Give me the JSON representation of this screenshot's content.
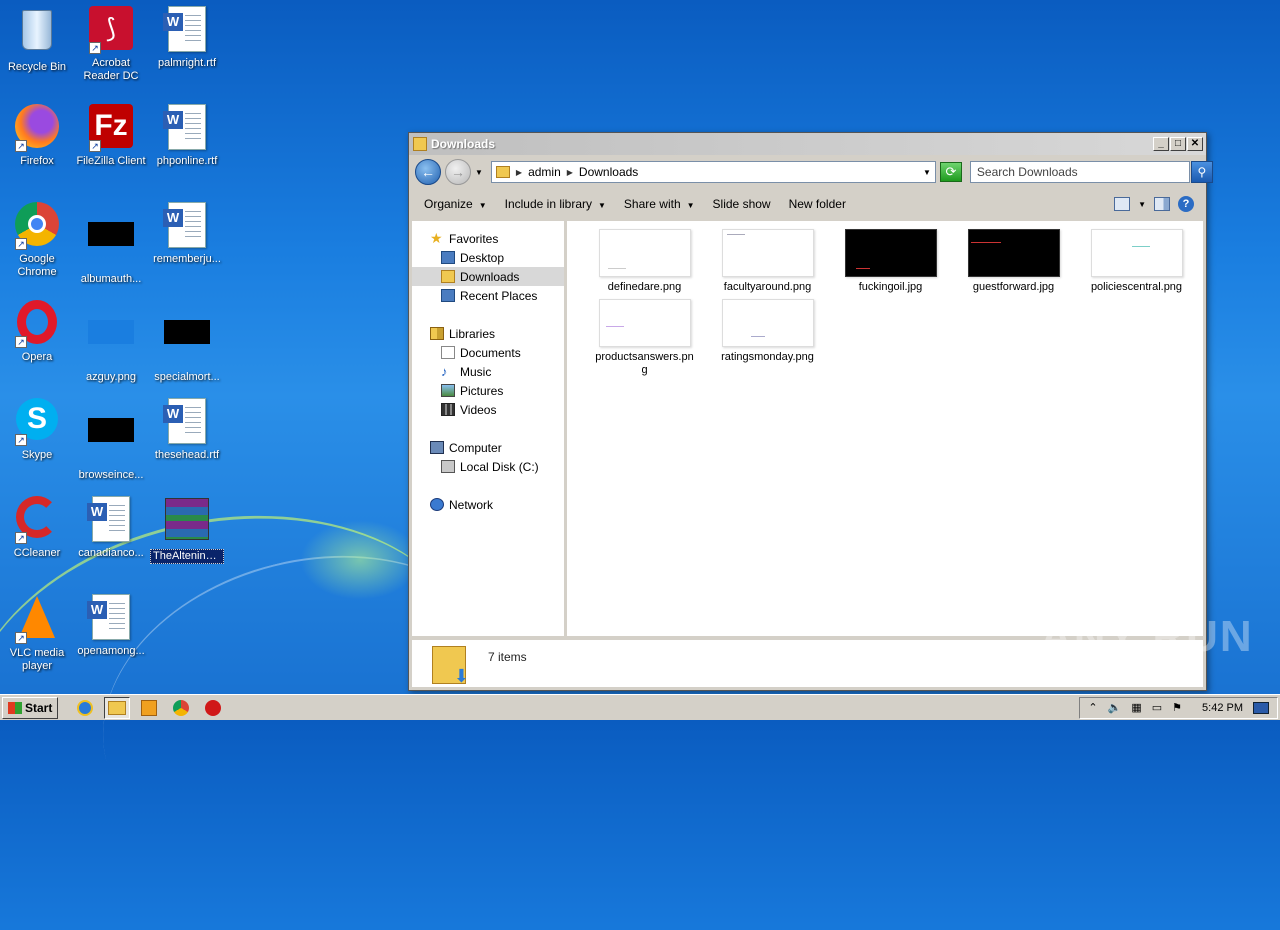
{
  "desktop": {
    "icons": [
      {
        "label": "Recycle Bin"
      },
      {
        "label": "Acrobat Reader DC"
      },
      {
        "label": "palmright.rtf"
      },
      {
        "label": "Firefox"
      },
      {
        "label": "FileZilla Client"
      },
      {
        "label": "phponline.rtf"
      },
      {
        "label": "Google Chrome"
      },
      {
        "label": "albumauth..."
      },
      {
        "label": "rememberju..."
      },
      {
        "label": "Opera"
      },
      {
        "label": "azguy.png"
      },
      {
        "label": "specialmort..."
      },
      {
        "label": "Skype"
      },
      {
        "label": "browseince..."
      },
      {
        "label": "thesehead.rtf"
      },
      {
        "label": "CCleaner"
      },
      {
        "label": "canadianco..."
      },
      {
        "label": "TheAltening.zip"
      },
      {
        "label": "VLC media player"
      },
      {
        "label": "openamong..."
      }
    ]
  },
  "window": {
    "title": "Downloads",
    "minimize": "_",
    "maximize": "□",
    "close": "✕",
    "breadcrumb": [
      "admin",
      "Downloads"
    ],
    "search_placeholder": "Search Downloads",
    "toolbar": {
      "organize": "Organize",
      "include": "Include in library",
      "share": "Share with",
      "slideshow": "Slide show",
      "newfolder": "New folder"
    },
    "nav": {
      "favorites": "Favorites",
      "desktop": "Desktop",
      "downloads": "Downloads",
      "recent": "Recent Places",
      "libraries": "Libraries",
      "documents": "Documents",
      "music": "Music",
      "pictures": "Pictures",
      "videos": "Videos",
      "computer": "Computer",
      "localdisk": "Local Disk (C:)",
      "network": "Network"
    },
    "files": [
      {
        "name": "definedare.png"
      },
      {
        "name": "facultyaround.png"
      },
      {
        "name": "fuckingoil.jpg"
      },
      {
        "name": "guestforward.jpg"
      },
      {
        "name": "policiescentral.png"
      },
      {
        "name": "productsanswers.png"
      },
      {
        "name": "ratingsmonday.png"
      }
    ],
    "status": "7 items"
  },
  "taskbar": {
    "start": "Start",
    "time": "5:42 PM"
  },
  "watermark": "ANY RUN"
}
